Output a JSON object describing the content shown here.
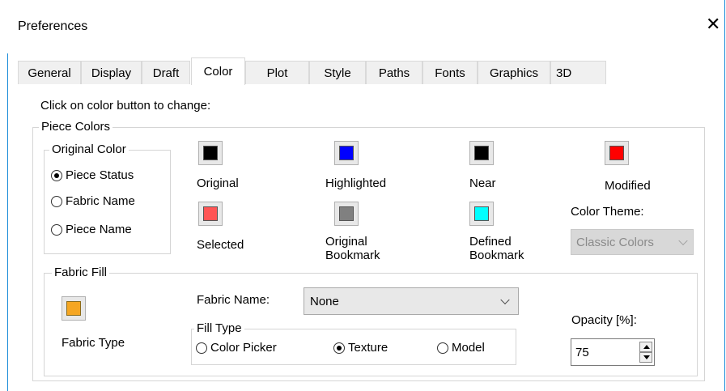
{
  "window": {
    "title": "Preferences",
    "close_symbol": "✕"
  },
  "tabs": [
    {
      "label": "General"
    },
    {
      "label": "Display"
    },
    {
      "label": "Draft"
    },
    {
      "label": "Color"
    },
    {
      "label": "Plot"
    },
    {
      "label": "Style"
    },
    {
      "label": "Paths"
    },
    {
      "label": "Fonts"
    },
    {
      "label": "Graphics"
    },
    {
      "label": "3D"
    }
  ],
  "active_tab": "Color",
  "instruction": "Click on color button to change:",
  "piece_colors": {
    "legend": "Piece Colors",
    "original_color": {
      "legend": "Original Color",
      "options": [
        {
          "label": "Piece Status",
          "selected": true
        },
        {
          "label": "Fabric Name",
          "selected": false
        },
        {
          "label": "Piece Name",
          "selected": false
        }
      ]
    },
    "swatches": {
      "original": {
        "label": "Original",
        "color": "#000000"
      },
      "highlighted": {
        "label": "Highlighted",
        "color": "#0000ff"
      },
      "near": {
        "label": "Near",
        "color": "#000000"
      },
      "modified": {
        "label": "Modified",
        "color": "#ff0000"
      },
      "selected": {
        "label": "Selected",
        "color": "#ff5555"
      },
      "original_bookmark": {
        "label1": "Original",
        "label2": "Bookmark",
        "color": "#808080"
      },
      "defined_bookmark": {
        "label1": "Defined",
        "label2": "Bookmark",
        "color": "#00ffff"
      }
    },
    "color_theme": {
      "label": "Color Theme:",
      "value": "Classic Colors",
      "enabled": false
    }
  },
  "fabric_fill": {
    "legend": "Fabric Fill",
    "fabric_type": {
      "label": "Fabric Type",
      "color": "#f5a623"
    },
    "fabric_name": {
      "label": "Fabric Name:",
      "value": "None"
    },
    "fill_type": {
      "legend": "Fill Type",
      "options": [
        {
          "label": "Color Picker",
          "selected": false
        },
        {
          "label": "Texture",
          "selected": true
        },
        {
          "label": "Model",
          "selected": false
        }
      ]
    },
    "opacity": {
      "label": "Opacity [%]:",
      "value": "75"
    }
  }
}
